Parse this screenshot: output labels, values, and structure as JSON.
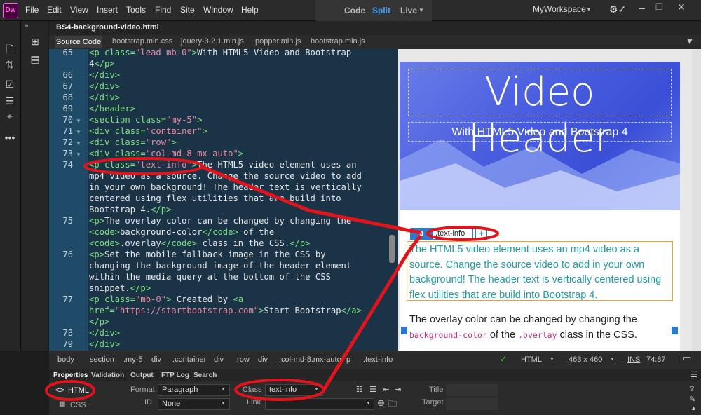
{
  "menubar": {
    "logo": "Dw",
    "items": [
      "File",
      "Edit",
      "View",
      "Insert",
      "Tools",
      "Find",
      "Site",
      "Window",
      "Help"
    ],
    "view_tabs": [
      "Code",
      "Split",
      "Live"
    ],
    "active_view": "Split",
    "workspace": "MyWorkspace"
  },
  "document": {
    "title": "BS4-background-video.html",
    "related_files": [
      "Source Code",
      "bootstrap.min.css",
      "jquery-3.2.1.min.js",
      "popper.min.js",
      "bootstrap.min.js"
    ]
  },
  "code": {
    "line_numbers": [
      "65",
      "66",
      "67",
      "68",
      "69",
      "70",
      "71",
      "72",
      "73",
      "74",
      "75",
      "76",
      "77",
      "78",
      "79"
    ]
  },
  "design": {
    "hero_title": "Video Header",
    "hero_subtitle": "With HTML5 Video and Bootstrap 4",
    "tag_label": "p",
    "class_label": ".text-info",
    "plus": "+",
    "p1": "The HTML5 video element uses an mp4 video as a source. Change the source video to add in your own background! The header text is vertically centered using flex utilities that are build into Bootstrap 4.",
    "p2_a": "The overlay color can be changed by changing the",
    "p2_code1": "background-color",
    "p2_b": "of the",
    "p2_code2": ".overlay",
    "p2_c": "class in the CSS."
  },
  "statusbar": {
    "crumbs": [
      "body",
      "section",
      ".my-5",
      "div",
      ".container",
      "div",
      ".row",
      "div",
      ".col-md-8.mx-auto",
      "p",
      ".text-info"
    ],
    "lang": "HTML",
    "size": "463 x 460",
    "mode": "INS",
    "position": "74:87"
  },
  "properties": {
    "tabs": [
      "Properties",
      "Validation",
      "Output",
      "FTP Log",
      "Search"
    ],
    "html_label": "HTML",
    "css_label": "CSS",
    "format_label": "Format",
    "format_value": "Paragraph",
    "id_label": "ID",
    "id_value": "None",
    "class_label": "Class",
    "class_value": "text-info",
    "link_label": "Link",
    "title_label": "Title",
    "target_label": "Target"
  },
  "colors": {
    "accent": "#2a7bd0",
    "annotation": "#e0141c",
    "text_info": "#1f9aa8"
  }
}
